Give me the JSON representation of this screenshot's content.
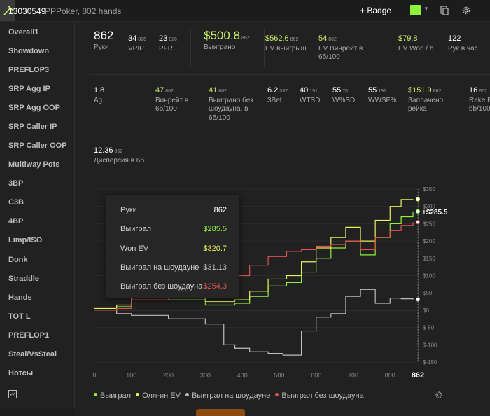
{
  "topbar": {
    "player_id": "13030549",
    "subtitle": "PPPoker, 802 hands",
    "badge_label": "+ Badge",
    "swatch_color": "#8ef23b"
  },
  "sidebar": {
    "items": [
      {
        "label": "Overall1"
      },
      {
        "label": "Showdown"
      },
      {
        "label": "PREFLOP3"
      },
      {
        "label": "SRP Agg IP"
      },
      {
        "label": "SRP Agg OOP"
      },
      {
        "label": "SRP Caller IP"
      },
      {
        "label": "SRP Caller OOP"
      },
      {
        "label": "Multiway Pots"
      },
      {
        "label": "3BP"
      },
      {
        "label": "C3B"
      },
      {
        "label": "4BP"
      },
      {
        "label": "Limp/ISO"
      },
      {
        "label": "Donk"
      },
      {
        "label": "Straddle"
      },
      {
        "label": "Hands"
      },
      {
        "label": "TOT L"
      },
      {
        "label": "PREFLOP1"
      },
      {
        "label": "Steal/VsSteal"
      },
      {
        "label": "Нотсы"
      }
    ]
  },
  "stats_top": [
    {
      "value": "862",
      "count": "",
      "label": "Руки"
    },
    {
      "value": "34",
      "count": "826",
      "label": "VPIP"
    },
    {
      "value": "23",
      "count": "826",
      "label": "PFR"
    },
    {
      "value": "$500.8",
      "count": "862",
      "label": "Выиграно"
    },
    {
      "value": "$562.6",
      "count": "862",
      "label": "EV выигрыш"
    },
    {
      "value": "54",
      "count": "862",
      "label": "EV Винрейт в 6б/100"
    },
    {
      "value": "$79.8",
      "count": "",
      "label": "EV Won / h"
    },
    {
      "value": "122",
      "count": "",
      "label": "Рук в час"
    }
  ],
  "stats_mid": [
    {
      "value": "1.8",
      "count": "",
      "label": "Ag."
    },
    {
      "value": "47",
      "count": "862",
      "label": "Винрейт в 6б/100"
    },
    {
      "value": "41",
      "count": "862",
      "label": "Выиграно без шоудауна, в 6б/100"
    },
    {
      "value": "6.2",
      "count": "337",
      "label": "3Bet"
    },
    {
      "value": "40",
      "count": "191",
      "label": "WTSD"
    },
    {
      "value": "55",
      "count": "78",
      "label": "W%SD"
    },
    {
      "value": "55",
      "count": "191",
      "label": "WWSF%"
    },
    {
      "value": "$151.9",
      "count": "862",
      "label": "Заплачено рейка"
    },
    {
      "value": "16",
      "count": "862",
      "label": "Rake P bb/100"
    }
  ],
  "stats_low": [
    {
      "value": "12.36",
      "count": "862",
      "label": "Дисперсия в 6б"
    }
  ],
  "tooltip": {
    "rows": [
      {
        "label": "Руки",
        "value": "862"
      },
      {
        "label": "Выиграл",
        "value": "$285.5"
      },
      {
        "label": "Won EV",
        "value": "$320.7"
      },
      {
        "label": "Выиграл на шоудауне",
        "value": "$31.13"
      },
      {
        "label": "Выиграл без шоудауна",
        "value": "$254.3"
      }
    ]
  },
  "chart_data": {
    "type": "line",
    "x_label_current": "862",
    "end_value_label": "+$285.5",
    "xlim": [
      0,
      862
    ],
    "ylim": [
      -150,
      350
    ],
    "x_ticks": [
      0,
      100,
      200,
      300,
      400,
      500,
      600,
      700,
      800
    ],
    "y_ticks": [
      350,
      300,
      250,
      200,
      150,
      100,
      50,
      0,
      -50,
      -100,
      -150
    ],
    "y_tick_labels": [
      "$350",
      "$300",
      "$250",
      "$200",
      "$150",
      "$100",
      "$50",
      "$0",
      "$-50",
      "$-100",
      "$-150"
    ],
    "colors": {
      "won": "#8ef23b",
      "ev": "#e6f05a",
      "sd": "#bdbdbd",
      "nsd": "#e0544f"
    },
    "series": [
      {
        "name": "Выиграл",
        "key": "won",
        "x": [
          0,
          60,
          100,
          200,
          300,
          380,
          420,
          470,
          520,
          560,
          600,
          640,
          680,
          720,
          760,
          800,
          830,
          862
        ],
        "values": [
          0,
          10,
          40,
          30,
          15,
          20,
          40,
          70,
          80,
          110,
          150,
          180,
          200,
          160,
          210,
          250,
          270,
          285.5
        ]
      },
      {
        "name": "Олл-ин EV",
        "key": "ev",
        "x": [
          0,
          60,
          100,
          200,
          300,
          380,
          420,
          470,
          520,
          560,
          600,
          640,
          680,
          720,
          760,
          800,
          830,
          862
        ],
        "values": [
          5,
          15,
          45,
          40,
          25,
          30,
          55,
          90,
          100,
          140,
          180,
          210,
          240,
          200,
          260,
          300,
          320,
          320.7
        ]
      },
      {
        "name": "Выиграл на шоудауне",
        "key": "sd",
        "x": [
          0,
          60,
          100,
          200,
          300,
          350,
          380,
          420,
          470,
          510,
          560,
          600,
          640,
          680,
          720,
          760,
          800,
          830,
          862
        ],
        "values": [
          0,
          -10,
          -15,
          -25,
          -40,
          -100,
          -110,
          -120,
          -125,
          -130,
          -60,
          -20,
          -10,
          40,
          60,
          20,
          35,
          33,
          31.13
        ]
      },
      {
        "name": "Выиграл без шоудауна",
        "key": "nsd",
        "x": [
          0,
          60,
          100,
          200,
          300,
          380,
          420,
          470,
          520,
          560,
          600,
          640,
          680,
          720,
          760,
          800,
          830,
          862
        ],
        "values": [
          0,
          5,
          30,
          60,
          80,
          100,
          130,
          155,
          170,
          175,
          185,
          190,
          200,
          175,
          210,
          230,
          245,
          254.3
        ]
      }
    ]
  },
  "legend": [
    {
      "label": "Выиграл",
      "color": "#8ef23b"
    },
    {
      "label": "Олл-ин EV",
      "color": "#e6f05a"
    },
    {
      "label": "Выиграл на шоудауне",
      "color": "#bdbdbd"
    },
    {
      "label": "Выиграл без шоудауна",
      "color": "#e0544f"
    }
  ]
}
